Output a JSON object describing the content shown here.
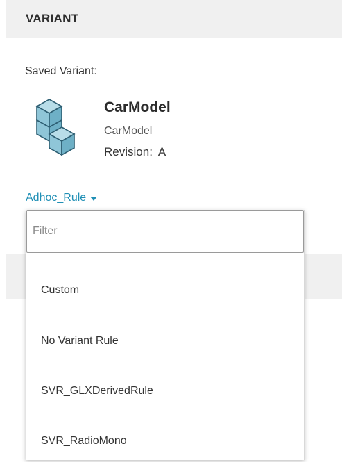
{
  "section": {
    "title": "VARIANT"
  },
  "saved": {
    "label": "Saved Variant:",
    "item_icon": "cube-stack-icon",
    "item_name": "CarModel",
    "item_sub": "CarModel",
    "revision_label": "Revision:",
    "revision_value": "A"
  },
  "rule": {
    "current": "Adhoc_Rule",
    "caret_icon": "caret-down-icon"
  },
  "dropdown": {
    "filter_placeholder": "Filter",
    "options": [
      "Custom",
      "No Variant Rule",
      "SVR_GLXDerivedRule",
      "SVR_RadioMono"
    ]
  },
  "colors": {
    "accent": "#1f8fb5",
    "header_bg": "#f0f0f0",
    "icon_fill": "#8fc6d8"
  }
}
